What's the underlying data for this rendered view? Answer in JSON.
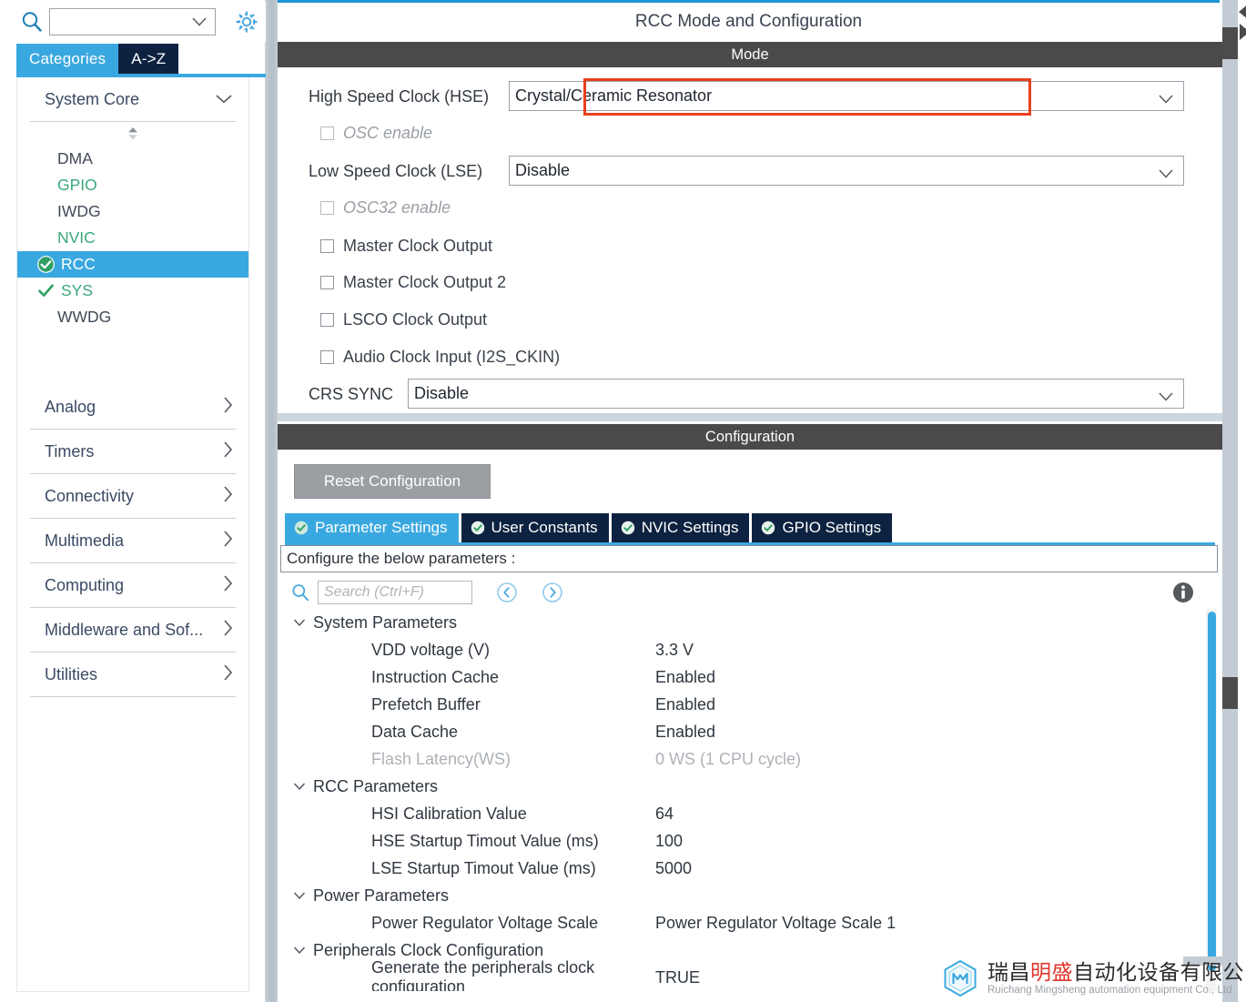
{
  "sidebar": {
    "search": {
      "value": "",
      "placeholder": ""
    },
    "gear_icon": "gear-icon",
    "search_icon": "search-icon",
    "tabs": [
      {
        "label": "Categories",
        "selected": true
      },
      {
        "label": "A->Z",
        "selected": false
      }
    ],
    "groups": [
      {
        "label": "System Core",
        "expanded": true,
        "items": [
          {
            "label": "DMA",
            "state": "none"
          },
          {
            "label": "GPIO",
            "state": "configured"
          },
          {
            "label": "IWDG",
            "state": "none"
          },
          {
            "label": "NVIC",
            "state": "configured"
          },
          {
            "label": "RCC",
            "state": "selected"
          },
          {
            "label": "SYS",
            "state": "checked"
          },
          {
            "label": "WWDG",
            "state": "none"
          }
        ]
      },
      {
        "label": "Analog",
        "expanded": false,
        "items": []
      },
      {
        "label": "Timers",
        "expanded": false,
        "items": []
      },
      {
        "label": "Connectivity",
        "expanded": false,
        "items": []
      },
      {
        "label": "Multimedia",
        "expanded": false,
        "items": []
      },
      {
        "label": "Computing",
        "expanded": false,
        "items": []
      },
      {
        "label": "Middleware and Sof...",
        "expanded": false,
        "items": []
      },
      {
        "label": "Utilities",
        "expanded": false,
        "items": []
      }
    ]
  },
  "panel": {
    "title": "RCC Mode and Configuration",
    "mode_bar": "Mode",
    "config_bar": "Configuration",
    "highlight_color": "#e8401e",
    "accent_color": "#3aa8e0",
    "dark_tab_color": "#0d2240"
  },
  "mode": {
    "hse": {
      "label": "High Speed Clock (HSE)",
      "value": "Crystal/Ceramic Resonator",
      "highlighted": true
    },
    "osc_enable": {
      "label": "OSC enable",
      "checked": false,
      "disabled": true
    },
    "lse": {
      "label": "Low Speed Clock (LSE)",
      "value": "Disable"
    },
    "osc32_enable": {
      "label": "OSC32 enable",
      "checked": false,
      "disabled": true
    },
    "checkboxes": [
      {
        "label": "Master Clock Output",
        "checked": false
      },
      {
        "label": "Master Clock Output 2",
        "checked": false
      },
      {
        "label": "LSCO Clock Output",
        "checked": false
      },
      {
        "label": "Audio Clock Input (I2S_CKIN)",
        "checked": false
      }
    ],
    "crs_sync": {
      "label": "CRS SYNC",
      "value": "Disable"
    }
  },
  "configuration": {
    "reset_button": "Reset Configuration",
    "tabs": [
      {
        "label": "Parameter Settings",
        "active": true
      },
      {
        "label": "User Constants",
        "active": false
      },
      {
        "label": "NVIC Settings",
        "active": false
      },
      {
        "label": "GPIO Settings",
        "active": false
      }
    ],
    "hint": "Configure the below parameters :",
    "search_placeholder": "Search (Ctrl+F)",
    "search_value": "",
    "nav_prev_icon": "chevron-left-circle-icon",
    "nav_next_icon": "chevron-right-circle-icon",
    "info_icon": "info-icon",
    "tree": [
      {
        "type": "group",
        "label": "System Parameters",
        "expanded": true
      },
      {
        "type": "item",
        "name": "VDD voltage (V)",
        "value": "3.3 V",
        "dim": false
      },
      {
        "type": "item",
        "name": "Instruction Cache",
        "value": "Enabled",
        "dim": false
      },
      {
        "type": "item",
        "name": "Prefetch Buffer",
        "value": "Enabled",
        "dim": false
      },
      {
        "type": "item",
        "name": "Data Cache",
        "value": "Enabled",
        "dim": false
      },
      {
        "type": "item",
        "name": "Flash Latency(WS)",
        "value": "0 WS (1 CPU cycle)",
        "dim": true
      },
      {
        "type": "group",
        "label": "RCC Parameters",
        "expanded": true
      },
      {
        "type": "item",
        "name": "HSI Calibration Value",
        "value": "64",
        "dim": false
      },
      {
        "type": "item",
        "name": "HSE Startup Timout Value (ms)",
        "value": "100",
        "dim": false
      },
      {
        "type": "item",
        "name": "LSE Startup Timout Value (ms)",
        "value": "5000",
        "dim": false
      },
      {
        "type": "group",
        "label": "Power Parameters",
        "expanded": true
      },
      {
        "type": "item",
        "name": "Power Regulator Voltage Scale",
        "value": "Power Regulator Voltage Scale 1",
        "dim": false
      },
      {
        "type": "group",
        "label": "Peripherals Clock Configuration",
        "expanded": true
      },
      {
        "type": "item",
        "name": "Generate the peripherals clock configuration",
        "value": "TRUE",
        "dim": false
      }
    ]
  },
  "watermark": {
    "cn_part1": "瑞昌",
    "cn_part2": "明盛",
    "cn_part3": "自动化设备有限公司",
    "en": "Ruichang Mingsheng automation equipment Co., Ltd",
    "accent": "#e0362c"
  }
}
